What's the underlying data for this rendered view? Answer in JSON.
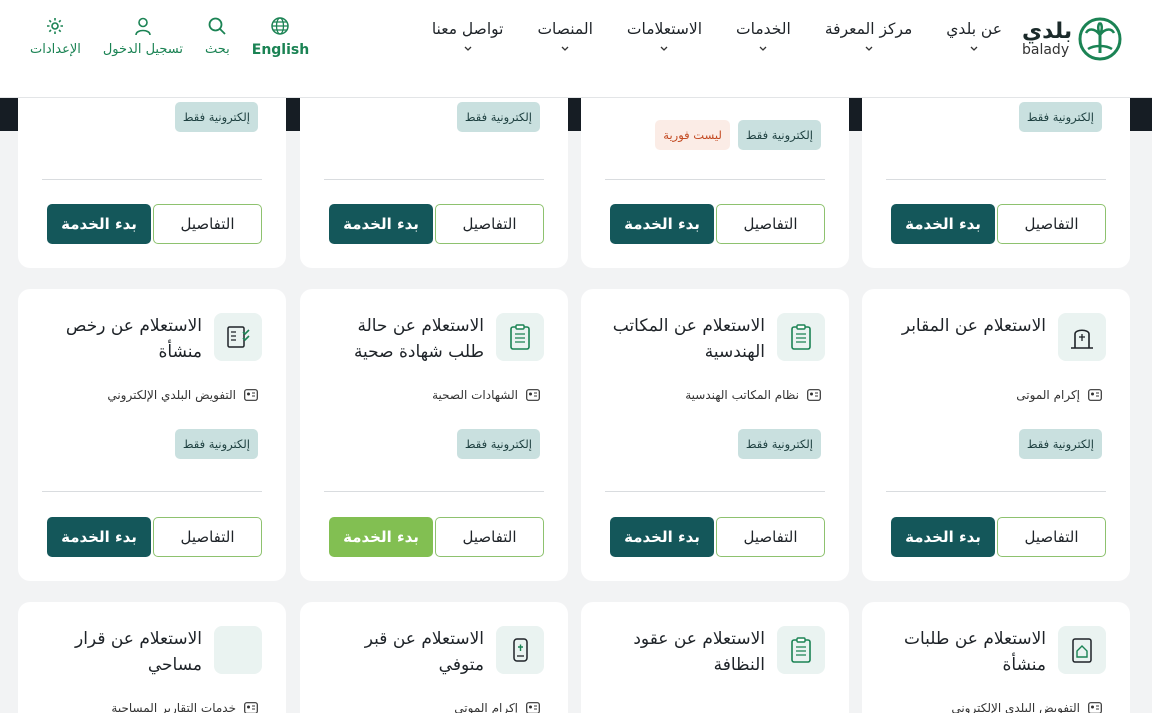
{
  "header": {
    "logo_ar": "بلدي",
    "logo_en": "balady",
    "nav": [
      {
        "label": "عن بلدي"
      },
      {
        "label": "مركز المعرفة"
      },
      {
        "label": "الخدمات"
      },
      {
        "label": "الاستعلامات"
      },
      {
        "label": "المنصات"
      },
      {
        "label": "تواصل معنا"
      }
    ],
    "tools": {
      "settings": "الإعدادات",
      "login": "تسجيل الدخول",
      "search": "بحث",
      "language": "English"
    }
  },
  "cards": {
    "row1": [
      {
        "badge1": "إلكترونية فقط",
        "details": "التفاصيل",
        "start": "بدء الخدمة"
      },
      {
        "badge1": "إلكترونية فقط",
        "badge2": "ليست فورية",
        "details": "التفاصيل",
        "start": "بدء الخدمة"
      },
      {
        "badge1": "إلكترونية فقط",
        "details": "التفاصيل",
        "start": "بدء الخدمة"
      },
      {
        "badge1": "إلكترونية فقط",
        "details": "التفاصيل",
        "start": "بدء الخدمة"
      }
    ],
    "row2": [
      {
        "title": "الاستعلام عن المقابر",
        "category": "إكرام الموتى",
        "badge1": "إلكترونية فقط",
        "details": "التفاصيل",
        "start": "بدء الخدمة",
        "icon": "tombstone-icon"
      },
      {
        "title": "الاستعلام عن المكاتب الهندسية",
        "category": "نظام المكاتب الهندسية",
        "badge1": "إلكترونية فقط",
        "details": "التفاصيل",
        "start": "بدء الخدمة",
        "icon": "clipboard-icon"
      },
      {
        "title": "الاستعلام عن حالة طلب شهادة صحية",
        "category": "الشهادات الصحية",
        "badge1": "إلكترونية فقط",
        "details": "التفاصيل",
        "start": "بدء الخدمة",
        "icon": "clipboard-icon"
      },
      {
        "title": "الاستعلام عن رخص منشأة",
        "category": "التفويض البلدي الإلكتروني",
        "badge1": "إلكترونية فقط",
        "details": "التفاصيل",
        "start": "بدء الخدمة",
        "icon": "checklist-icon"
      }
    ],
    "row3": [
      {
        "title": "الاستعلام عن طلبات منشأة",
        "category": "التفويض البلدي الإلكتروني",
        "icon": "building-doc-icon"
      },
      {
        "title": "الاستعلام عن عقود النظافة",
        "category": "",
        "icon": "clipboard-icon"
      },
      {
        "title": "الاستعلام عن قبر متوفي",
        "category": "إكرام الموتى",
        "icon": "grave-phone-icon"
      },
      {
        "title": "الاستعلام عن قرار مساحي",
        "category": "خدمات التقارير المساحية",
        "icon": "blank-icon"
      }
    ]
  },
  "colors": {
    "brand": "#14575a",
    "accent_green": "#82bf52",
    "badge_bg": "#c9e0df",
    "warn": "#c34a22"
  }
}
